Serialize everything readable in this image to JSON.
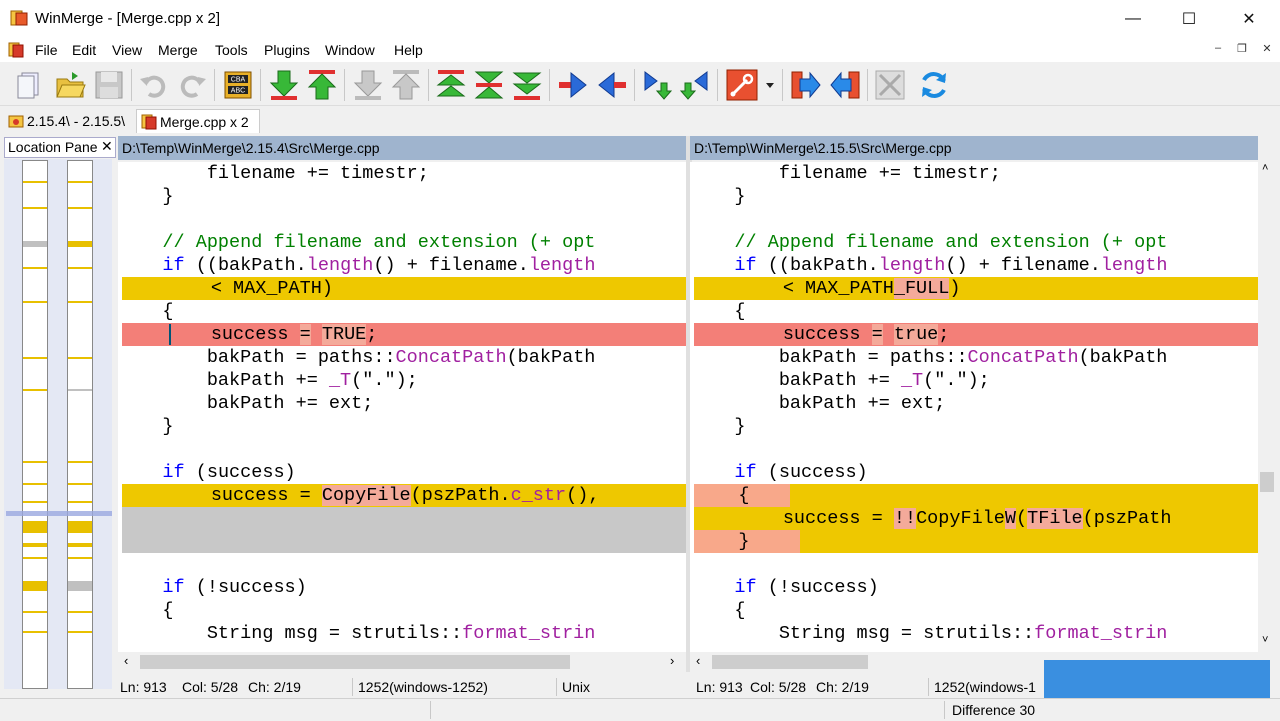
{
  "window": {
    "title": "WinMerge - [Merge.cpp x 2]",
    "minimize": "—",
    "maximize": "☐",
    "close": "✕"
  },
  "menu": {
    "items": [
      "File",
      "Edit",
      "View",
      "Merge",
      "Tools",
      "Plugins",
      "Window",
      "Help"
    ]
  },
  "mdi_controls": {
    "minimize": "–",
    "restore": "❐",
    "close": "✕"
  },
  "tabs": [
    {
      "label": "2.15.4\\ - 2.15.5\\"
    },
    {
      "label": "Merge.cpp x 2"
    }
  ],
  "location_pane": {
    "title": "Location Pane",
    "close": "✕"
  },
  "left": {
    "path": "D:\\Temp\\WinMerge\\2.15.4\\Src\\Merge.cpp",
    "status": {
      "ln": "Ln: 913",
      "col": "Col: 5/28",
      "ch": "Ch: 2/19",
      "enc": "1252(windows-1252)",
      "eol": "Unix"
    }
  },
  "right": {
    "path": "D:\\Temp\\WinMerge\\2.15.5\\Src\\Merge.cpp",
    "status": {
      "ln": "Ln: 913",
      "col": "Col: 5/28",
      "ch": "Ch: 2/19",
      "enc": "1252(windows-1"
    }
  },
  "code": {
    "l1": "        filename += timestr;",
    "l2": "    }",
    "l3a": "    ",
    "l3b": "// Append filename and extension (+ opt",
    "l4a": "    ",
    "l4kw": "if",
    "l4b": " ((bakPath.",
    "l4fn": "length",
    "l4c": "() + filename.",
    "l4fn2": "length",
    "l5": "        < MAX_PATH)",
    "l5r_a": "        < MAX_PATH",
    "l5r_b": "_FULL",
    "l5r_c": ")",
    "l6": "    {",
    "l7a": "        success ",
    "l7b": "=",
    "l7c": " ",
    "l7L": "TRUE",
    "l7R": "true",
    "l7d": ";",
    "l8a": "        bakPath = paths::",
    "l8fn": "ConcatPath",
    "l8b": "(bakPath",
    "l9a": "        bakPath += ",
    "l9fn": "_T",
    "l9b": "(\".\");",
    "l10": "        bakPath += ext;",
    "l11": "    }",
    "l13kw": "if",
    "l13b": " (success)",
    "l14L_a": "        success = ",
    "l14L_b": "CopyFile",
    "l14L_c": "(pszPath.",
    "l14L_d": "c_str",
    "l14L_e": "(),",
    "l14R": "    {",
    "l15R_a": "        success = ",
    "l15R_b": "!!",
    "l15R_c": "CopyFile",
    "l15R_d": "W",
    "l15R_e": "(",
    "l15R_f": "TFile",
    "l15R_g": "(pszPath",
    "l16R": "    }",
    "l18kw": "if",
    "l18b": " (!success)",
    "l19": "    {",
    "l20a": "        String msg = strutils::",
    "l20fn": "format_strin"
  },
  "status_bottom": {
    "difference": "Difference 30"
  },
  "colors": {
    "diff_yellow": "#eec800",
    "diff_red": "#f37f78",
    "diff_gray": "#c8c8c8",
    "header": "#9fb4ce"
  },
  "icons": [
    "new-icon",
    "open-icon",
    "save-icon",
    "undo-icon",
    "redo-icon",
    "refresh-compare-icon",
    "next-diff-icon",
    "prev-diff-icon",
    "first-diff-icon",
    "last-diff-icon",
    "copy-right-icon",
    "copy-left-icon",
    "options-icon",
    "refresh-icon"
  ]
}
